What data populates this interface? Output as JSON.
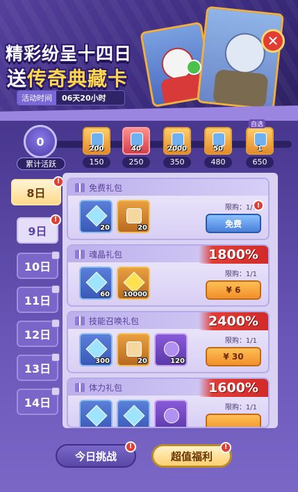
{
  "banner": {
    "title_line1": "精彩纷呈十四日",
    "title_line2_pre": "送",
    "title_line2_main": "传奇典藏卡",
    "time_label": "活动时间",
    "time_value": "06天20小时",
    "close_icon": "close-icon"
  },
  "progress": {
    "total_value": "0",
    "total_label": "累计活跃",
    "milestones": [
      {
        "count": "200",
        "value": "150"
      },
      {
        "count": "40",
        "value": "250"
      },
      {
        "count": "2000",
        "value": "350"
      },
      {
        "count": "50",
        "value": "480"
      },
      {
        "count": "1",
        "value": "650",
        "tag": "自选"
      }
    ]
  },
  "days": [
    {
      "label": "8日"
    },
    {
      "label": "9日"
    },
    {
      "label": "10日"
    },
    {
      "label": "11日"
    },
    {
      "label": "12日"
    },
    {
      "label": "13日"
    },
    {
      "label": "14日"
    }
  ],
  "badge": "!",
  "packs": [
    {
      "title": "免费礼包",
      "discount": "",
      "items": [
        {
          "count": "20"
        },
        {
          "count": "20"
        }
      ],
      "limit": "限购：1/1",
      "button": "免费"
    },
    {
      "title": "魂晶礼包",
      "discount": "1800%",
      "items": [
        {
          "count": "60"
        },
        {
          "count": "10000"
        }
      ],
      "limit": "限购：1/1",
      "button": "¥ 6"
    },
    {
      "title": "技能召唤礼包",
      "discount": "2400%",
      "items": [
        {
          "count": "300"
        },
        {
          "count": "20"
        },
        {
          "count": "120"
        }
      ],
      "limit": "限购：1/1",
      "button": "¥ 30"
    },
    {
      "title": "体力礼包",
      "discount": "1600%",
      "items": [
        {
          "count": ""
        },
        {
          "count": ""
        },
        {
          "count": ""
        }
      ],
      "limit": "限购：1/1",
      "button": ""
    }
  ],
  "bottom": {
    "challenge": "今日挑战",
    "welfare": "超值福利"
  }
}
